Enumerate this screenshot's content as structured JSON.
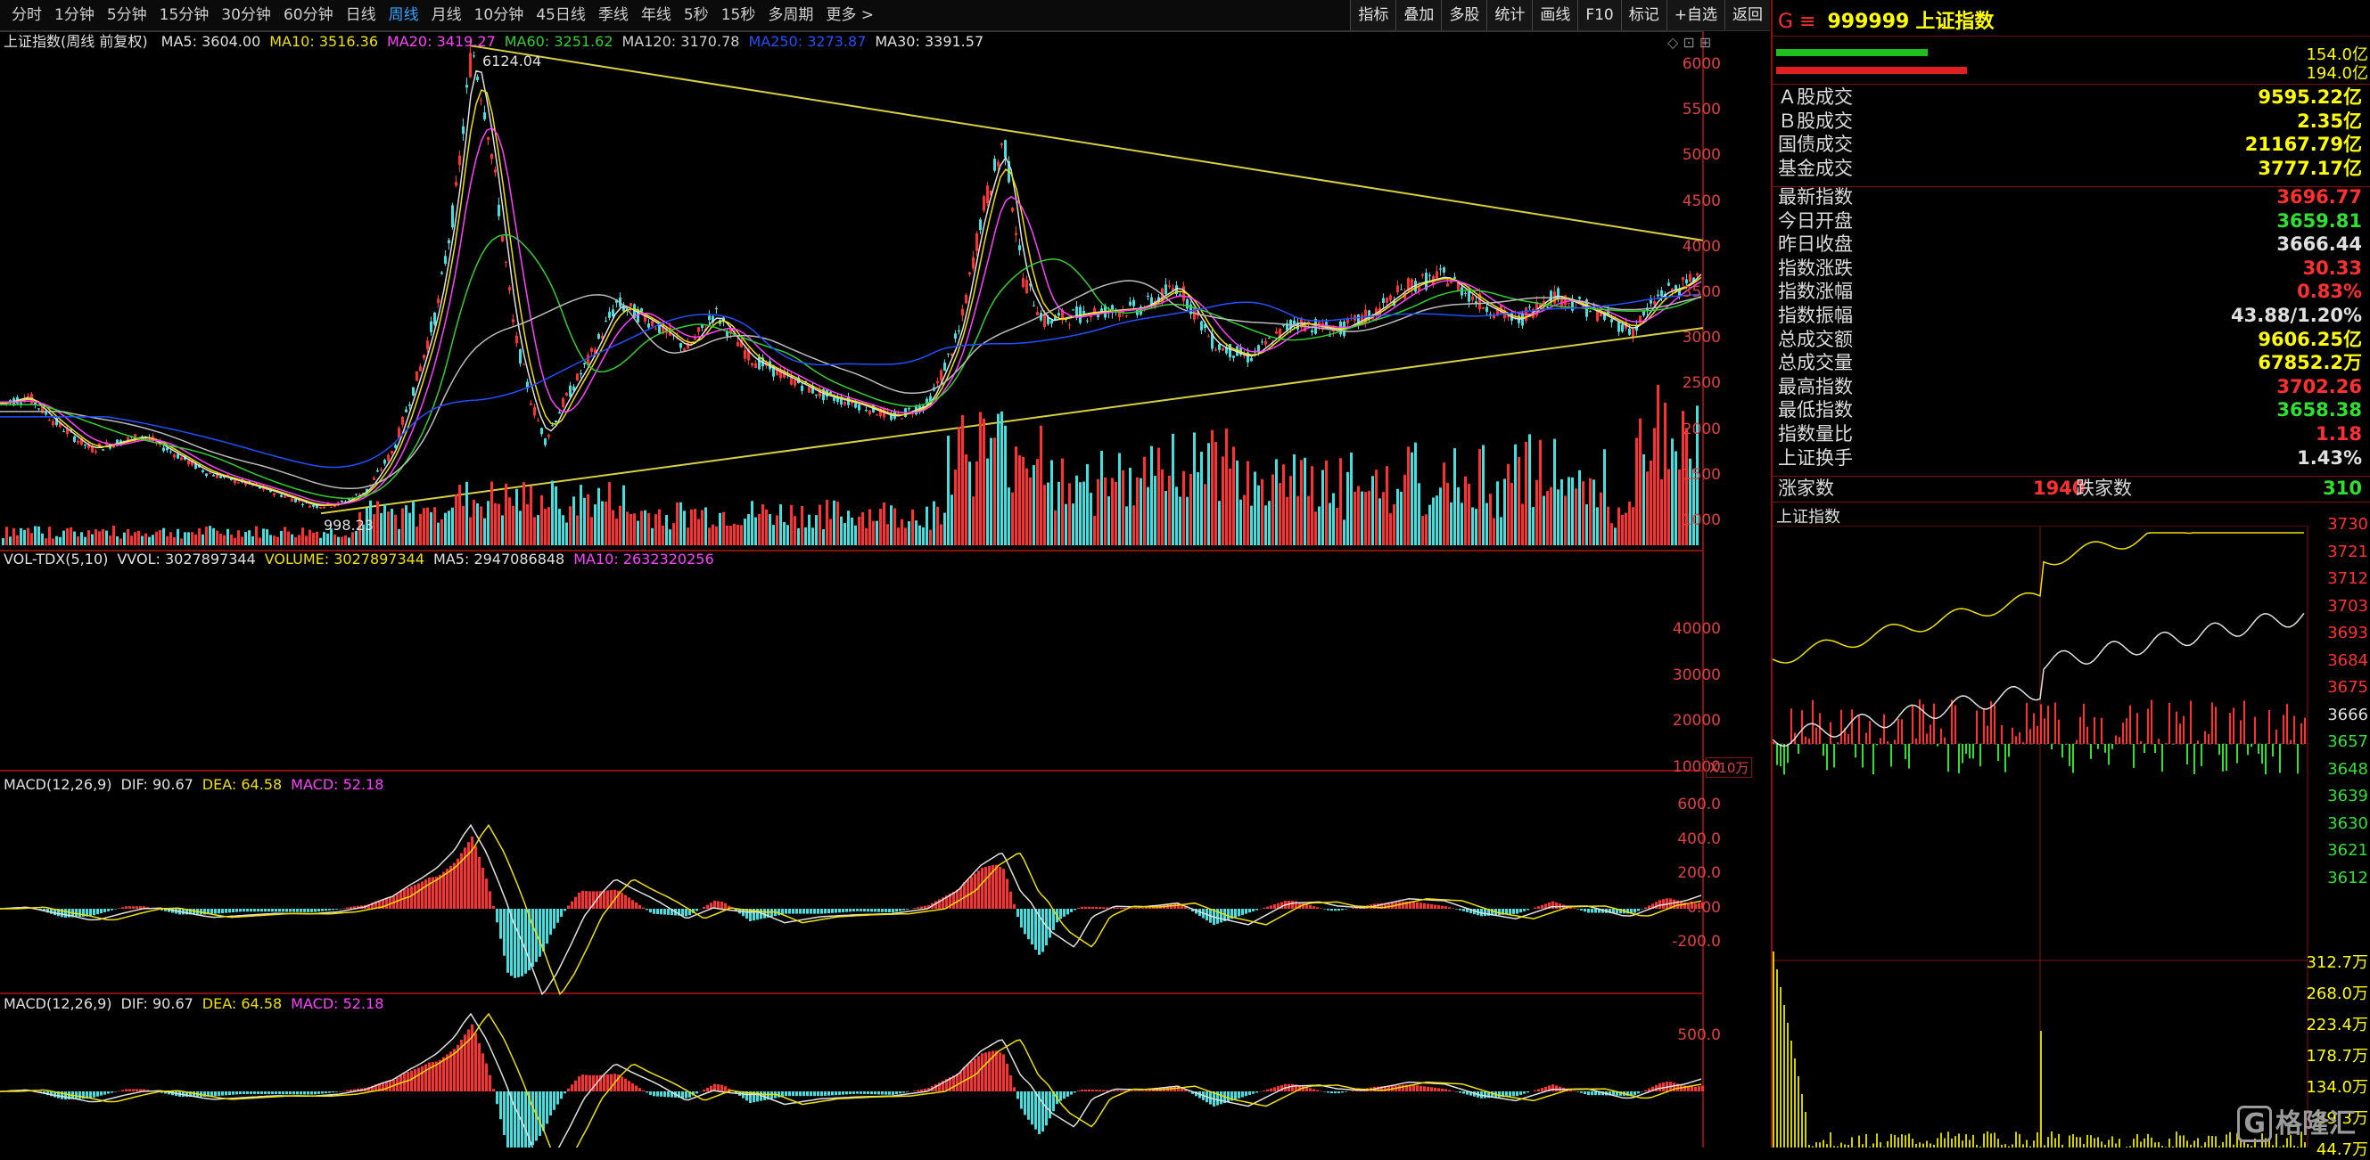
{
  "toolbar": {
    "periods": [
      "分时",
      "1分钟",
      "5分钟",
      "15分钟",
      "30分钟",
      "60分钟",
      "日线",
      "周线",
      "月线",
      "10分钟",
      "45日线",
      "季线",
      "年线",
      "5秒",
      "15秒",
      "多周期",
      "更多 >"
    ],
    "active_period": "周线",
    "tools": [
      "指标",
      "叠加",
      "多股",
      "统计",
      "画线",
      "F10",
      "标记",
      "+自选",
      "返回"
    ]
  },
  "main_chart": {
    "title": "上证指数(周线 前复权)",
    "ma_items": [
      {
        "label": "MA5: 3604.00",
        "color": "#e0e0e0"
      },
      {
        "label": "MA10: 3516.36",
        "color": "#f0e000"
      },
      {
        "label": "MA20: 3419.27",
        "color": "#ff40ff"
      },
      {
        "label": "MA60: 3251.62",
        "color": "#30d030"
      },
      {
        "label": "MA120: 3170.78",
        "color": "#cfcfcf"
      },
      {
        "label": "MA250: 3273.87",
        "color": "#2050ff"
      },
      {
        "label": "MA30: 3391.57",
        "color": "#e0e0e0"
      }
    ],
    "high_label": "6124.04",
    "low_label": "998.23",
    "y_ticks": [
      "6000",
      "5500",
      "5000",
      "4500",
      "4000",
      "3500",
      "3000",
      "2500",
      "2000",
      "1500",
      "1000"
    ]
  },
  "vol_chart": {
    "items": [
      {
        "label": "VOL-TDX(5,10)",
        "color": "#e0e0e0"
      },
      {
        "label": "VVOL: 3027897344",
        "color": "#e0e0e0"
      },
      {
        "label": "VOLUME: 3027897344",
        "color": "#f0e000"
      },
      {
        "label": "MA5: 2947086848",
        "color": "#e0e0e0"
      },
      {
        "label": "MA10: 2632320256",
        "color": "#ff40ff"
      }
    ],
    "y_ticks": [
      "40000",
      "30000",
      "20000",
      "10000"
    ],
    "unit": "X10万"
  },
  "macd1": {
    "items": [
      {
        "label": "MACD(12,26,9)",
        "color": "#e0e0e0"
      },
      {
        "label": "DIF: 90.67",
        "color": "#e0e0e0"
      },
      {
        "label": "DEA: 64.58",
        "color": "#f0e000"
      },
      {
        "label": "MACD: 52.18",
        "color": "#ff40ff"
      }
    ],
    "y_ticks": [
      "600.0",
      "400.0",
      "200.0",
      "0.00",
      "-200.0"
    ]
  },
  "macd2": {
    "items": [
      {
        "label": "MACD(12,26,9)",
        "color": "#e0e0e0"
      },
      {
        "label": "DIF: 90.67",
        "color": "#e0e0e0"
      },
      {
        "label": "DEA: 64.58",
        "color": "#f0e000"
      },
      {
        "label": "MACD: 52.18",
        "color": "#ff40ff"
      }
    ],
    "y_ticks": [
      "500.0"
    ]
  },
  "quote": {
    "code_prefix": "G ≡",
    "code": "999999",
    "name": "上证指数",
    "bar_values": [
      "154.0亿",
      "194.0亿"
    ],
    "turnover": [
      {
        "k": "Ａ股成交",
        "v": "9595.22亿",
        "c": "#ffff00"
      },
      {
        "k": "Ｂ股成交",
        "v": "2.35亿",
        "c": "#ffff00"
      },
      {
        "k": "国债成交",
        "v": "21167.79亿",
        "c": "#ffff00"
      },
      {
        "k": "基金成交",
        "v": "3777.17亿",
        "c": "#ffff00"
      }
    ],
    "stats": [
      {
        "k": "最新指数",
        "v": "3696.77",
        "c": "#ff3030"
      },
      {
        "k": "今日开盘",
        "v": "3659.81",
        "c": "#30e030"
      },
      {
        "k": "昨日收盘",
        "v": "3666.44",
        "c": "#e0e0e0"
      },
      {
        "k": "指数涨跌",
        "v": "30.33",
        "c": "#ff3030"
      },
      {
        "k": "指数涨幅",
        "v": "0.83%",
        "c": "#ff3030"
      },
      {
        "k": "指数振幅",
        "v": "43.88/1.20%",
        "c": "#e0e0e0"
      },
      {
        "k": "总成交额",
        "v": "9606.25亿",
        "c": "#ffff00"
      },
      {
        "k": "总成交量",
        "v": "67852.2万",
        "c": "#ffff00"
      },
      {
        "k": "最高指数",
        "v": "3702.26",
        "c": "#ff3030"
      },
      {
        "k": "最低指数",
        "v": "3658.38",
        "c": "#30e030"
      },
      {
        "k": "指数量比",
        "v": "1.18",
        "c": "#ff3030"
      },
      {
        "k": "上证换手",
        "v": "1.43%",
        "c": "#e0e0e0"
      }
    ],
    "breadth": {
      "up_label": "涨家数",
      "up": "1940",
      "down_label": "跌家数",
      "down": "310"
    }
  },
  "intraday": {
    "title": "上证指数",
    "price_ticks": [
      "3730",
      "3721",
      "3712",
      "3703",
      "3693",
      "3684",
      "3675",
      "3666",
      "3657",
      "3648",
      "3639",
      "3630",
      "3621",
      "3612"
    ],
    "vol_ticks": [
      "312.7万",
      "268.0万",
      "223.4万",
      "178.7万",
      "134.0万",
      "89.3万",
      "44.7万"
    ]
  },
  "watermark": "格隆汇",
  "colors": {
    "up": "#ff3030",
    "down": "#40e0e0",
    "ma5": "#e0e0e0",
    "ma10": "#f0e000",
    "ma20": "#ff40ff",
    "ma60": "#30d030",
    "ma250": "#2050ff",
    "trend": "#d8d040"
  }
}
